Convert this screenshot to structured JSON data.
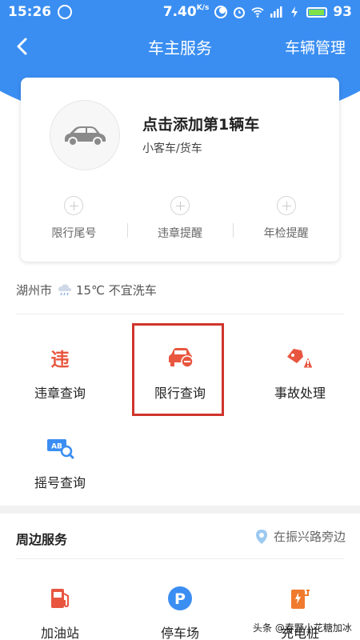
{
  "status_bar": {
    "time": "15:26",
    "net_speed": "7.40",
    "net_unit": "K/s",
    "battery": "93"
  },
  "nav": {
    "title": "车主服务",
    "right_action": "车辆管理"
  },
  "car_card": {
    "add_title": "点击添加第1辆车",
    "car_type": "小客车/货车",
    "reminders": [
      {
        "label": "限行尾号"
      },
      {
        "label": "违章提醒"
      },
      {
        "label": "年检提醒"
      }
    ]
  },
  "weather": {
    "city": "湖州市",
    "text": "15℃ 不宜洗车"
  },
  "services": [
    {
      "label": "违章查询",
      "icon": "violation-icon",
      "color": "#e8563f"
    },
    {
      "label": "限行查询",
      "icon": "restriction-car-icon",
      "color": "#e8563f"
    },
    {
      "label": "事故处理",
      "icon": "accident-car-icon",
      "color": "#e8563f"
    },
    {
      "label": "摇号查询",
      "icon": "lottery-search-icon",
      "color": "#3a8ef2"
    }
  ],
  "nearby": {
    "title": "周边服务",
    "location": "在振兴路旁边",
    "items": [
      {
        "label": "加油站",
        "icon": "gas-station-icon"
      },
      {
        "label": "停车场",
        "icon": "parking-icon"
      },
      {
        "label": "充电桩",
        "icon": "charging-station-icon"
      }
    ]
  },
  "watermark": "头条 @春野小花糖加冰",
  "colors": {
    "header_blue": "#3a8ef2",
    "accent_red": "#e8563f",
    "highlight_red": "#d0342c"
  }
}
